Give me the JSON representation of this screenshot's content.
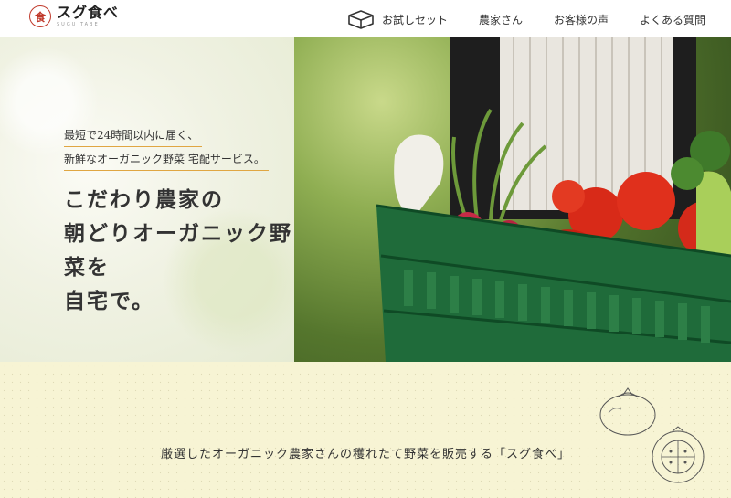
{
  "brand": {
    "mark": "食",
    "name": "スグ食べ",
    "sub": "SUGU TABE"
  },
  "nav": {
    "items": [
      {
        "label": "お試しセット",
        "icon": "box-icon"
      },
      {
        "label": "農家さん"
      },
      {
        "label": "お客様の声"
      },
      {
        "label": "よくある質問"
      }
    ]
  },
  "hero": {
    "tagline_1": "最短で24時間以内に届く、",
    "tagline_2": "新鮮なオーガニック野菜 宅配サービス。",
    "headline": [
      "こだわり農家の",
      "朝どりオーガニック野",
      "菜を",
      "自宅で。"
    ]
  },
  "intro": {
    "text": "厳選したオーガニック農家さんの穫れたて野菜を販売する「スグ食べ」"
  },
  "colors": {
    "accent_underline": "#e0a642",
    "brand_red": "#c0392b",
    "lower_bg": "#f7f4d4"
  }
}
